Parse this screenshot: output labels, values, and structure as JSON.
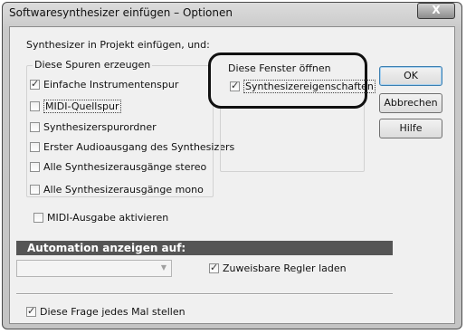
{
  "window": {
    "title": "Softwaresynthesizer einfügen – Optionen",
    "close_glyph": "X"
  },
  "insert_label": "Synthesizer in Projekt einfügen, und:",
  "tracks_group": {
    "title": "Diese Spuren erzeugen",
    "items": [
      {
        "label": "Einfache Instrumentenspur",
        "checked": true
      },
      {
        "label": "MIDI-Quellspur",
        "checked": false
      },
      {
        "label": "Synthesizerspurordner",
        "checked": false
      },
      {
        "label": "Erster Audioausgang des Synthesizers",
        "checked": false
      },
      {
        "label": "Alle Synthesizerausgänge stereo",
        "checked": false
      },
      {
        "label": "Alle Synthesizerausgänge mono",
        "checked": false
      }
    ]
  },
  "windows_group": {
    "title": "Diese Fenster öffnen",
    "items": [
      {
        "label": "Synthesizereigenschaften",
        "checked": true
      }
    ]
  },
  "buttons": {
    "ok": "OK",
    "cancel": "Abbrechen",
    "help": "Hilfe"
  },
  "midi_output": {
    "label": "MIDI-Ausgabe aktivieren",
    "checked": false
  },
  "automation": {
    "header": "Automation anzeigen auf:",
    "select_value": ""
  },
  "assignable": {
    "label": "Zuweisbare Regler laden",
    "checked": true
  },
  "ask_every_time": {
    "label": "Diese Frage jedes Mal stellen",
    "checked": true
  }
}
